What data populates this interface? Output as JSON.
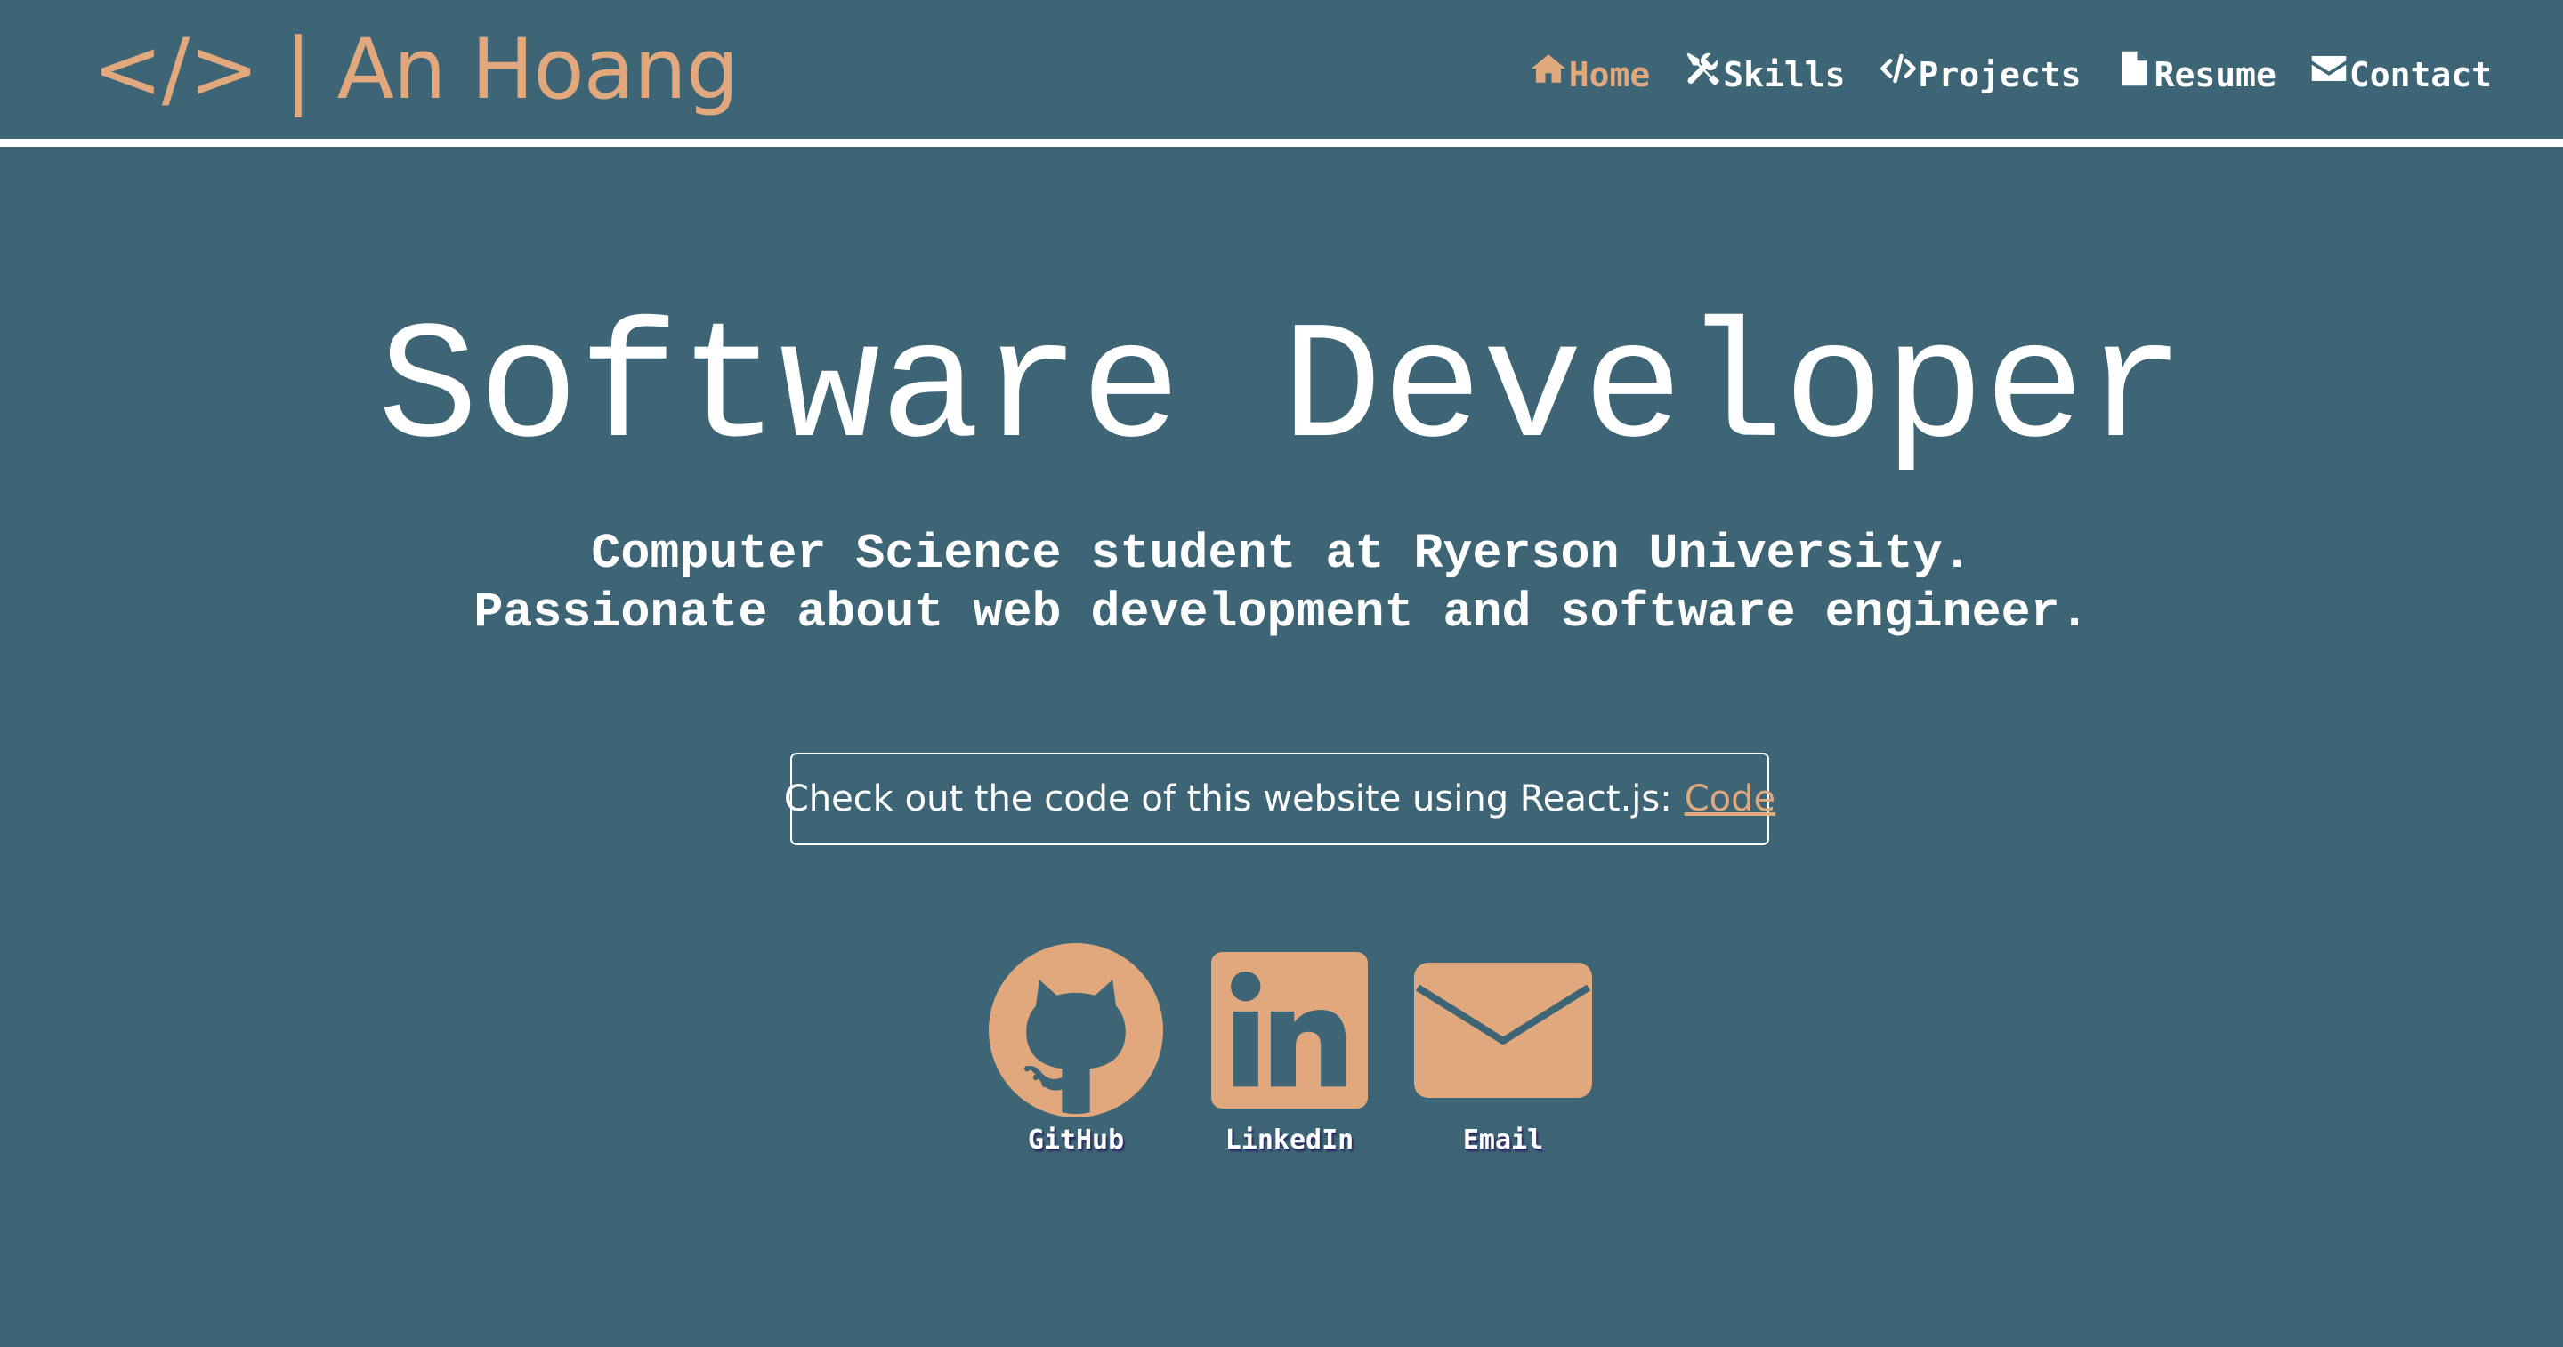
{
  "header": {
    "logo_text": "</> | An Hoang",
    "nav": [
      {
        "label": "Home",
        "icon": "home-icon",
        "active": true
      },
      {
        "label": "Skills",
        "icon": "tools-icon",
        "active": false
      },
      {
        "label": "Projects",
        "icon": "code-icon",
        "active": false
      },
      {
        "label": "Resume",
        "icon": "file-icon",
        "active": false
      },
      {
        "label": "Contact",
        "icon": "envelope-icon",
        "active": false
      }
    ]
  },
  "hero": {
    "title": "Software Developer",
    "subtitle_line1": "Computer Science student at Ryerson University.",
    "subtitle_line2": "Passionate about web development and software engineer.",
    "code_text": "Check out the code of this website using React.js:",
    "code_link": "Code"
  },
  "socials": [
    {
      "label": "GitHub",
      "icon": "github-icon"
    },
    {
      "label": "LinkedIn",
      "icon": "linkedin-icon"
    },
    {
      "label": "Email",
      "icon": "email-icon"
    }
  ],
  "colors": {
    "background": "#3d6575",
    "accent": "#e0a87c",
    "text": "#ffffff"
  }
}
